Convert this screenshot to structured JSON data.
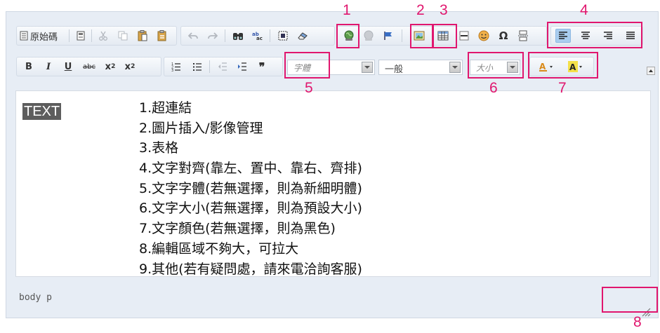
{
  "toolbar": {
    "source_label": "原始碼",
    "font_placeholder": "字體",
    "format_value": "一般",
    "size_placeholder": "大小"
  },
  "content": {
    "selected_text": "TEXT",
    "items": [
      "1.超連結",
      "2.圖片插入/影像管理",
      "3.表格",
      "4.文字對齊(靠左、置中、靠右、齊排)",
      "5.文字字體(若無選擇，則為新細明體)",
      "6.文字大小(若無選擇，則為預設大小)",
      "7.文字顏色(若無選擇，則為黑色)",
      "8.編輯區域不夠大，可拉大",
      "9.其他(若有疑問處，請來電洽詢客服)"
    ]
  },
  "statusbar": {
    "path": "body  p"
  },
  "callouts": [
    "1",
    "2",
    "3",
    "4",
    "5",
    "6",
    "7",
    "8"
  ],
  "colors": {
    "highlight": "#e0166e",
    "selection_bg": "#5d5d5d",
    "active_button": "#a9cdef"
  }
}
